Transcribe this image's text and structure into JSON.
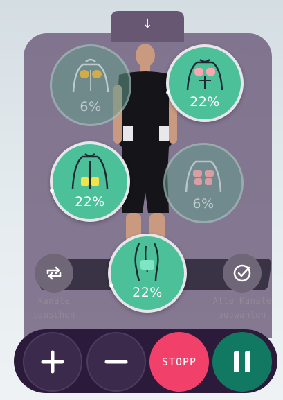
{
  "top_handle": {
    "icon": "arrow-down-icon",
    "glyph": "↓"
  },
  "channels": [
    {
      "id": "upper-back",
      "percent": "6%",
      "active": false,
      "highlight_color": "#e3b23c"
    },
    {
      "id": "chest",
      "percent": "22%",
      "active": true,
      "highlight_color": "#f7a7ae"
    },
    {
      "id": "lower-back",
      "percent": "22%",
      "active": true,
      "highlight_color": "#f2e34a"
    },
    {
      "id": "abdomen",
      "percent": "6%",
      "active": false,
      "highlight_color": "#f2a2aa"
    },
    {
      "id": "legs",
      "percent": "22%",
      "active": true,
      "highlight_color": "#7ee6c4"
    }
  ],
  "side_controls": {
    "swap": {
      "label_line1": "Kanäle",
      "label_line2": "tauschen",
      "icon": "swap-arrows-icon"
    },
    "select_all": {
      "label_line1": "Alle Kanäle",
      "label_line2": "auswählen",
      "icon": "check-circle-icon"
    }
  },
  "bottom_controls": {
    "plus_icon": "plus-icon",
    "minus_icon": "minus-icon",
    "stop_label": "STOPP",
    "pause_icon": "pause-icon"
  },
  "colors": {
    "accent_green": "#4cc098",
    "stop_red": "#f1416a",
    "pause_green": "#117861",
    "panel_purple": "#685676",
    "bar_dark": "#2c1a3b"
  }
}
